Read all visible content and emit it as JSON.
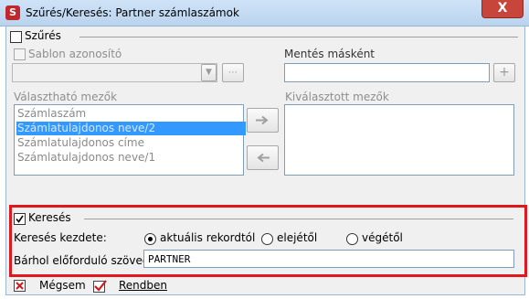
{
  "window": {
    "title": "Szűrés/Keresés: Partner számlaszámok",
    "close_label": "X"
  },
  "filter": {
    "section_label": "Szűrés",
    "template_label": "Sablon azonosító",
    "save_as_label": "Mentés másként",
    "add_label": "+"
  },
  "fields": {
    "available_label": "Választható mezők",
    "selected_label": "Kiválasztott mezők",
    "available_items": [
      "Számlaszám",
      "Számlatulajdonos neve/2",
      "Számlatulajdonos címe",
      "Számlatulajdonos neve/1"
    ],
    "selected_index": 1
  },
  "search": {
    "section_label": "Keresés",
    "start_label": "Keresés kezdete:",
    "options": [
      "aktuális rekordtól",
      "elejétől",
      "végétől"
    ],
    "selected_option": 0,
    "text_label": "Bárhol előforduló szöveg:",
    "text_value": "PARTNER"
  },
  "footer": {
    "cancel_label": "Mégsem",
    "ok_label": "Rendben"
  }
}
